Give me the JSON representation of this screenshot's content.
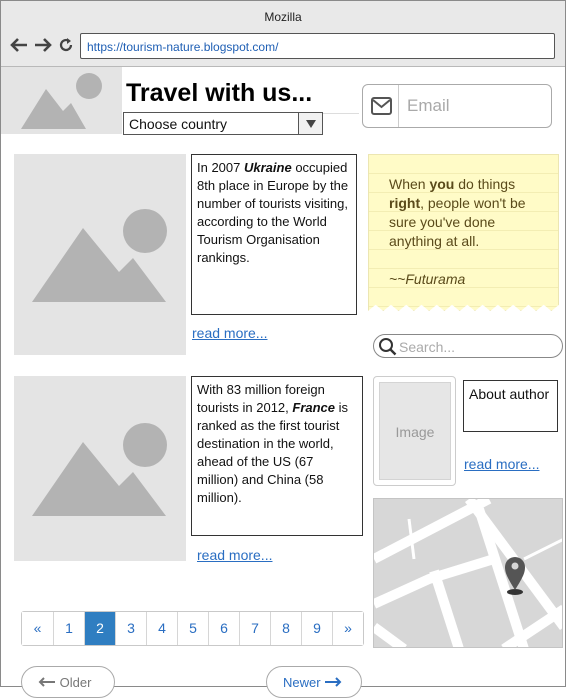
{
  "browser": {
    "window_title": "Mozilla",
    "url": "https://tourism-nature.blogspot.com/",
    "nav_icons": [
      "back-arrow-icon",
      "forward-arrow-icon",
      "reload-icon"
    ]
  },
  "header": {
    "title": "Travel with us...",
    "country_select": {
      "selected": "Choose country"
    },
    "email": {
      "placeholder": "Email",
      "icon": "envelope-icon"
    }
  },
  "posts": [
    {
      "text_before": "In 2007 ",
      "emph": "Ukraine",
      "text_after": " occupied 8th place in Europe by the number of tourists visiting, according to the World Tourism Organisation rankings.",
      "read_more": "read more..."
    },
    {
      "text_before": " With 83 million foreign tourists in 2012, ",
      "emph": "France",
      "text_after": " is ranked as the first tourist destination in the world, ahead of the US (67 million) and China (58 million).",
      "read_more": "read more..."
    }
  ],
  "sidebar": {
    "quote": {
      "p1": "When ",
      "b1": "you",
      "p2": " do things ",
      "b2": "right",
      "p3": ", people won't be sure you've done anything at all.",
      "attribution": "~~Futurama"
    },
    "search": {
      "placeholder": "Search..."
    },
    "author": {
      "image_label": "Image",
      "about": "About author",
      "read_more": "read more..."
    }
  },
  "pagination": {
    "prev": "«",
    "pages": [
      "1",
      "2",
      "3",
      "4",
      "5",
      "6",
      "7",
      "8",
      "9"
    ],
    "active": "2",
    "next": "»"
  },
  "bottom_nav": {
    "older": "Older",
    "newer": "Newer"
  },
  "colors": {
    "accent": "#2f7ec1",
    "link": "#2a6ec2",
    "note_bg": "#fffbc7"
  }
}
